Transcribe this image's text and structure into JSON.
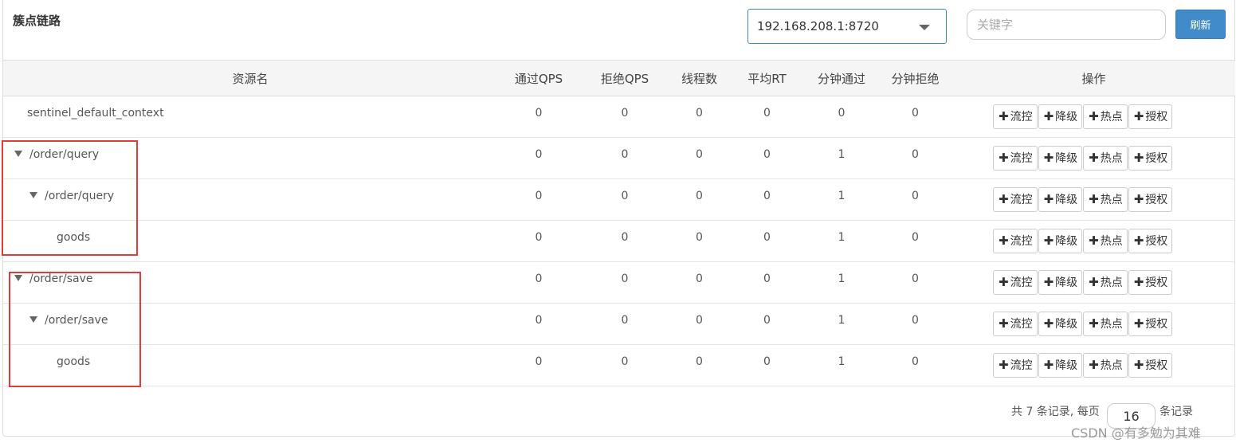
{
  "header": {
    "title": "簇点链路",
    "machine_select": "192.168.208.1:8720",
    "search_placeholder": "关键字",
    "refresh_label": "刷新"
  },
  "table": {
    "columns": [
      "资源名",
      "通过QPS",
      "拒绝QPS",
      "线程数",
      "平均RT",
      "分钟通过",
      "分钟拒绝",
      "操作"
    ],
    "rows": [
      {
        "name": "sentinel_default_context",
        "pass_qps": "0",
        "block_qps": "0",
        "threads": "0",
        "avg_rt": "0",
        "min_pass": "0",
        "min_block": "0"
      },
      {
        "name": "/order/query",
        "pass_qps": "0",
        "block_qps": "0",
        "threads": "0",
        "avg_rt": "0",
        "min_pass": "1",
        "min_block": "0"
      },
      {
        "name": "/order/query",
        "pass_qps": "0",
        "block_qps": "0",
        "threads": "0",
        "avg_rt": "0",
        "min_pass": "1",
        "min_block": "0"
      },
      {
        "name": "goods",
        "pass_qps": "0",
        "block_qps": "0",
        "threads": "0",
        "avg_rt": "0",
        "min_pass": "1",
        "min_block": "0"
      },
      {
        "name": "/order/save",
        "pass_qps": "0",
        "block_qps": "0",
        "threads": "0",
        "avg_rt": "0",
        "min_pass": "1",
        "min_block": "0"
      },
      {
        "name": "/order/save",
        "pass_qps": "0",
        "block_qps": "0",
        "threads": "0",
        "avg_rt": "0",
        "min_pass": "1",
        "min_block": "0"
      },
      {
        "name": "goods",
        "pass_qps": "0",
        "block_qps": "0",
        "threads": "0",
        "avg_rt": "0",
        "min_pass": "1",
        "min_block": "0"
      }
    ],
    "actions": {
      "flow": "流控",
      "degrade": "降级",
      "hot": "热点",
      "auth": "授权"
    }
  },
  "footer": {
    "total_text": "共 7 条记录, 每页",
    "page_size": "16",
    "suffix": "条记录"
  },
  "watermark": "CSDN @有多勉为其难",
  "colors": {
    "accent": "#428bca",
    "highlight_box": "#e03c3c"
  }
}
